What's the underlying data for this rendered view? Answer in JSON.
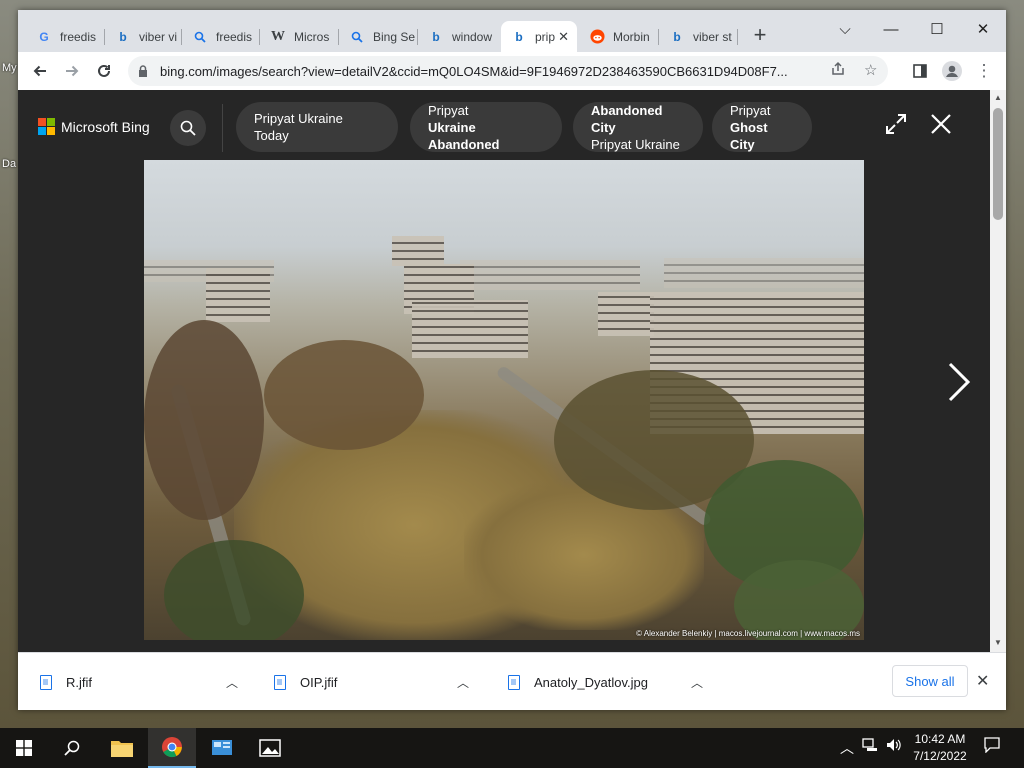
{
  "desktop": {
    "labels": [
      "My",
      "Da"
    ]
  },
  "tabs": [
    {
      "title": "freedis",
      "favicon": "G",
      "favicon_color": "#4285f4"
    },
    {
      "title": "viber vi",
      "favicon": "b",
      "favicon_color": "#1b6ec2"
    },
    {
      "title": "freedis",
      "favicon": "search",
      "favicon_color": "#1a73e8"
    },
    {
      "title": "Micros",
      "favicon": "W",
      "favicon_color": "#000000"
    },
    {
      "title": "Bing Se",
      "favicon": "search",
      "favicon_color": "#1a73e8"
    },
    {
      "title": "window",
      "favicon": "b",
      "favicon_color": "#1b6ec2"
    },
    {
      "title": "prip",
      "favicon": "b",
      "favicon_color": "#1b6ec2",
      "active": true
    },
    {
      "title": "Morbin",
      "favicon": "reddit",
      "favicon_color": "#ff4500"
    },
    {
      "title": "viber st",
      "favicon": "b",
      "favicon_color": "#1b6ec2"
    }
  ],
  "newtab_label": "+",
  "window_controls": {
    "chevron": "⌵",
    "minimize": "—",
    "maximize": "☐",
    "close": "✕"
  },
  "address_bar": {
    "url": "bing.com/images/search?view=detailV2&ccid=mQ0LO4SM&id=9F1946972D238463590CB6631D94D08F7..."
  },
  "bing": {
    "logo_text": "Microsoft Bing",
    "logo_colors": [
      "#f25022",
      "#7fba00",
      "#00a4ef",
      "#ffb900"
    ],
    "chips": [
      {
        "line1": "Pripyat Ukraine Today",
        "line2": "",
        "bold_line": 0
      },
      {
        "line1": "Pripyat",
        "line2": "Ukraine Abandoned",
        "bold_line": 2
      },
      {
        "line1": "Abandoned City",
        "line2": "Pripyat Ukraine",
        "bold_line": 1
      },
      {
        "line1": "Pripyat",
        "line2": "Ghost City",
        "bold_line": 2
      }
    ],
    "image_credit": "© Alexander Belenkiy | macos.livejournal.com | www.macos.ms"
  },
  "downloads": [
    {
      "name": "R.jfif"
    },
    {
      "name": "OIP.jfif"
    },
    {
      "name": "Anatoly_Dyatlov.jpg"
    }
  ],
  "show_all_label": "Show all",
  "taskbar": {
    "time": "10:42 AM",
    "date": "7/12/2022"
  }
}
